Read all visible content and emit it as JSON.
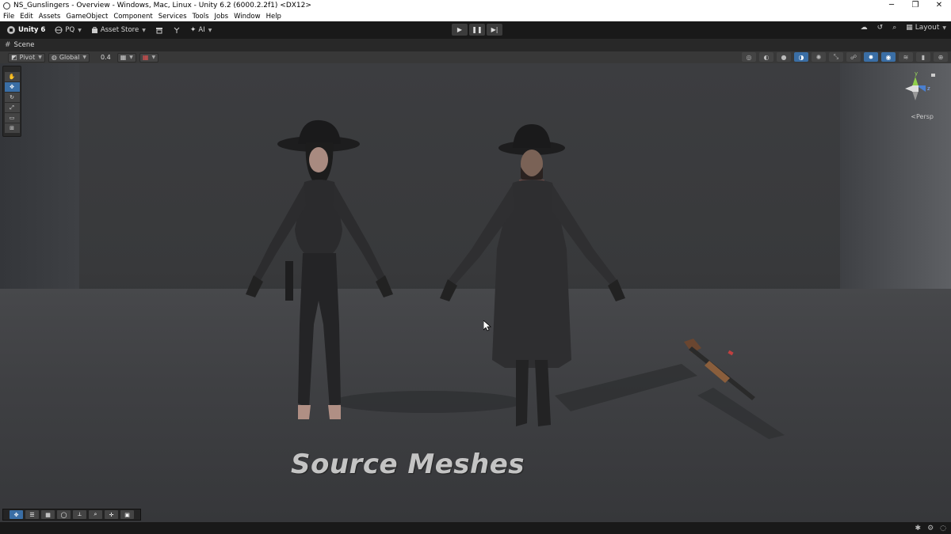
{
  "window": {
    "title": "NS_Gunslingers - Overview - Windows, Mac, Linux - Unity 6.2 (6000.2.2f1) <DX12>",
    "controls": {
      "minimize": "─",
      "maximize": "❐",
      "close": "✕"
    }
  },
  "menu": [
    "File",
    "Edit",
    "Assets",
    "GameObject",
    "Component",
    "Services",
    "Tools",
    "Jobs",
    "Window",
    "Help"
  ],
  "toolbar": {
    "account": "Unity 6",
    "org": "PQ",
    "asset_store": "Asset Store",
    "ai": "AI",
    "layout": "Layout"
  },
  "scene_tab": {
    "label": "Scene"
  },
  "scene_toolbar": {
    "pivot": "Pivot",
    "global": "Global",
    "snap_value": "0.4"
  },
  "gizmo": {
    "y": "y",
    "z": "z",
    "projection": "Persp"
  },
  "viewport": {
    "label": "Source Meshes"
  },
  "colors": {
    "accent": "#3a6ea5",
    "background": "#191919"
  }
}
